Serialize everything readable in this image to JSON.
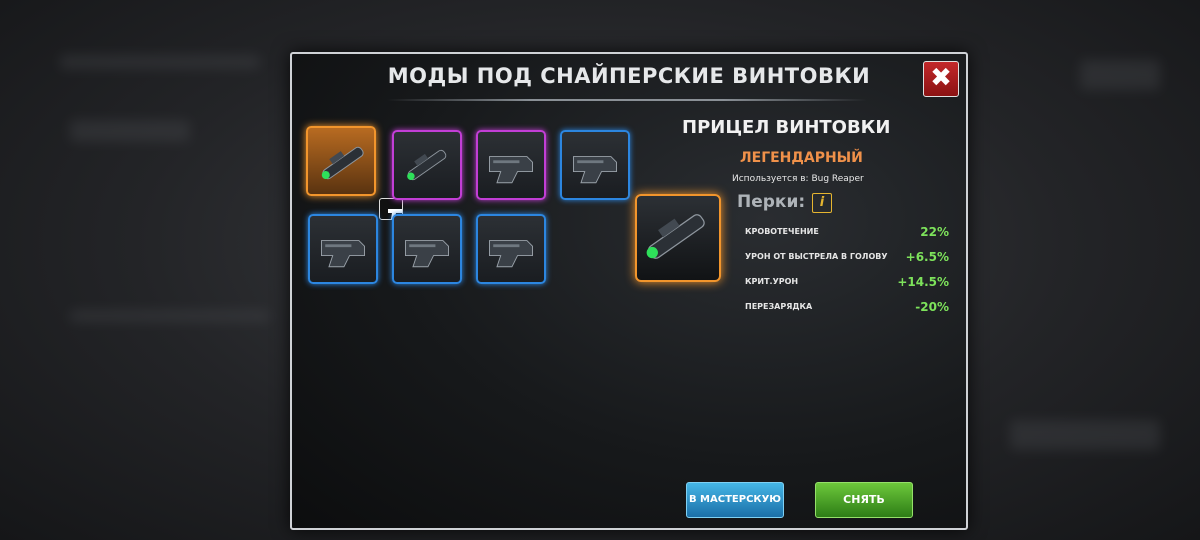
{
  "modal": {
    "title": "МОДЫ ПОД СНАЙПЕРСКИЕ ВИНТОВКИ",
    "close_icon": "close-x-icon"
  },
  "slots": [
    {
      "rarity": "legendary",
      "color": "#f2952c",
      "item": "scope",
      "equipped": true,
      "badge_icon": "pistol-icon"
    },
    {
      "rarity": "epic",
      "color": "#c23ed6",
      "item": "scope"
    },
    {
      "rarity": "epic",
      "color": "#c23ed6",
      "item": "stock"
    },
    {
      "rarity": "rare",
      "color": "#2c86e0",
      "item": "stock"
    },
    {
      "rarity": "rare",
      "color": "#2c86e0",
      "item": "stock"
    },
    {
      "rarity": "rare",
      "color": "#2c86e0",
      "item": "stock"
    },
    {
      "rarity": "rare",
      "color": "#2c86e0",
      "item": "stock"
    }
  ],
  "detail": {
    "name": "ПРИЦЕЛ ВИНТОВКИ",
    "rarity": "ЛЕГЕНДАРНЫЙ",
    "rarity_color": "#f0914a",
    "used_in": "Используется в: Bug Reaper",
    "perks_label": "Перки:",
    "info_icon": "info-icon",
    "perks": [
      {
        "label": "КРОВОТЕЧЕНИЕ",
        "value": "22%"
      },
      {
        "label": "УРОН ОТ ВЫСТРЕЛА В ГОЛОВУ",
        "value": "+6.5%"
      },
      {
        "label": "КРИТ.УРОН",
        "value": "+14.5%"
      },
      {
        "label": "ПЕРЕЗАРЯДКА",
        "value": "-20%"
      }
    ]
  },
  "buttons": {
    "workshop": "В МАСТЕРСКУЮ",
    "remove": "СНЯТЬ"
  }
}
